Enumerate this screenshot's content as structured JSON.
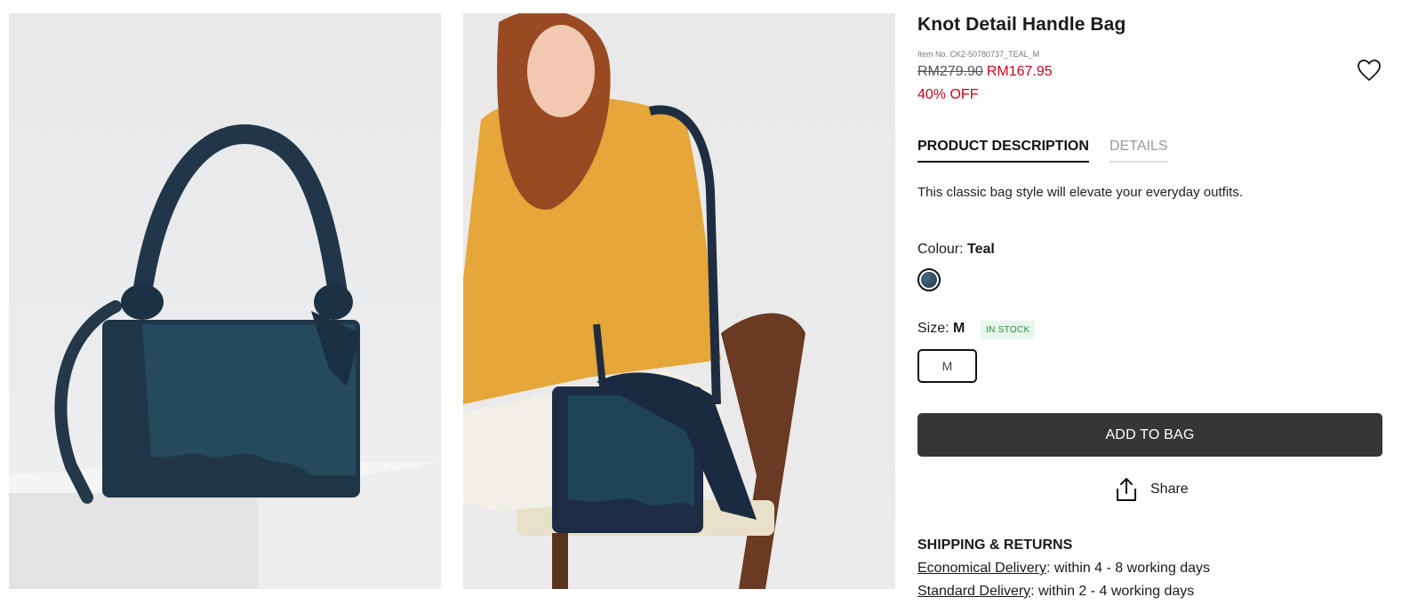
{
  "product": {
    "title": "Knot Detail Handle Bag",
    "item_no": "Item No. CK2-50780737_TEAL_M",
    "price_old": "RM279.90",
    "price_new": "RM167.95",
    "discount": "40% OFF"
  },
  "tabs": [
    {
      "label": "PRODUCT DESCRIPTION",
      "active": true
    },
    {
      "label": "DETAILS",
      "active": false
    }
  ],
  "description": "This classic bag style will elevate your everyday outfits.",
  "colour": {
    "label": "Colour:",
    "value": "Teal",
    "swatch_color": "#2d4a5c"
  },
  "size": {
    "label": "Size:",
    "value": "M",
    "stock": "IN STOCK",
    "option": "M"
  },
  "add_to_bag": "ADD TO BAG",
  "share": "Share",
  "shipping": {
    "title": "SHIPPING & RETURNS",
    "lines": [
      {
        "link": "Economical Delivery",
        "text": ": within 4 - 8 working days"
      },
      {
        "link": "Standard Delivery",
        "text": ": within 2 - 4 working days"
      }
    ]
  },
  "colors": {
    "accent_red": "#d0021b",
    "button_dark": "#363636",
    "stock_green": "#2e8b45"
  }
}
